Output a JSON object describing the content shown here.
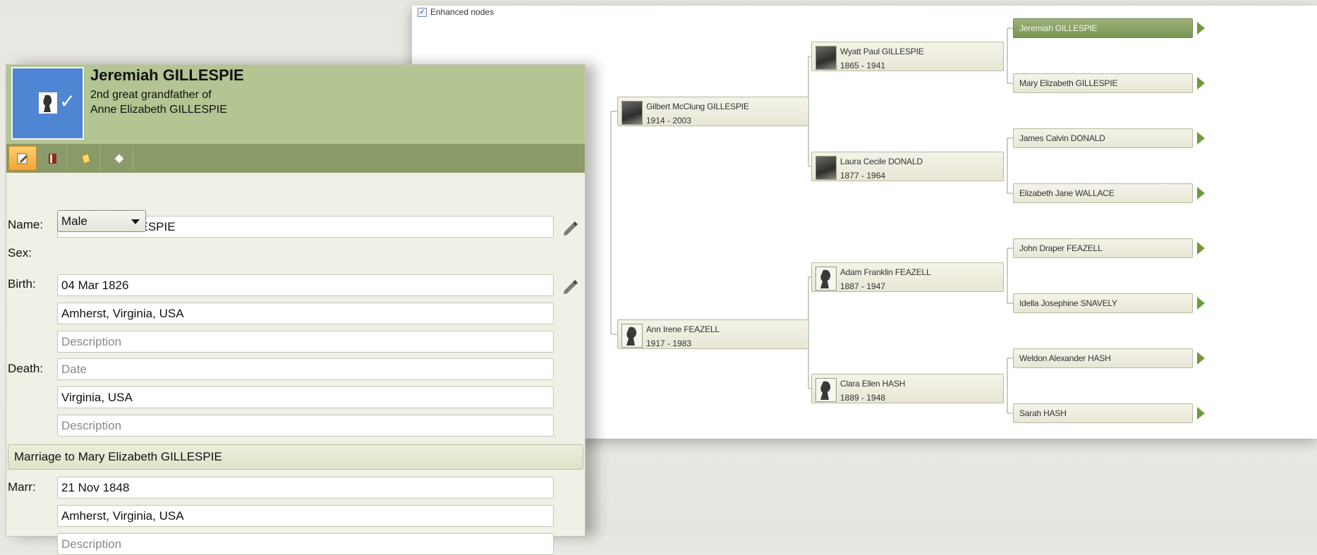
{
  "tree": {
    "enhanced_nodes_label": "Enhanced nodes",
    "enhanced_nodes_checked": true,
    "nodes": {
      "gilbert": {
        "name": "Gilbert McClung GILLESPIE",
        "dates": "1914 - 2003"
      },
      "ann": {
        "name": "Ann Irene FEAZELL",
        "dates": "1917 - 1983"
      },
      "wyatt": {
        "name": "Wyatt Paul GILLESPIE",
        "dates": "1865 - 1941"
      },
      "laura": {
        "name": "Laura Cecile DONALD",
        "dates": "1877 - 1964"
      },
      "adam": {
        "name": "Adam Franklin FEAZELL",
        "dates": "1887 - 1947"
      },
      "clara": {
        "name": "Clara Ellen HASH",
        "dates": "1889 - 1948"
      }
    },
    "leaves": [
      {
        "name": "Jeremiah GILLESPIE",
        "selected": true
      },
      {
        "name": "Mary Elizabeth GILLESPIE"
      },
      {
        "name": "James Calvin DONALD"
      },
      {
        "name": "Elizabeth Jane WALLACE"
      },
      {
        "name": "John Draper FEAZELL"
      },
      {
        "name": "Idella Josephine SNAVELY"
      },
      {
        "name": "Weldon Alexander HASH"
      },
      {
        "name": "Sarah HASH"
      }
    ]
  },
  "editor": {
    "name": "Jeremiah GILLESPIE",
    "relation_line1": "2nd great grandfather of",
    "relation_line2": "Anne Elizabeth GILLESPIE",
    "labels": {
      "name": "Name:",
      "sex": "Sex:",
      "birth": "Birth:",
      "death": "Death:",
      "marr": "Marr:"
    },
    "fields": {
      "name_value": "Jeremiah GILLESPIE",
      "sex_value": "Male",
      "birth_date": "04 Mar 1826",
      "birth_place": "Amherst, Virginia, USA",
      "birth_description_placeholder": "Description",
      "death_date_placeholder": "Date",
      "death_place": "Virginia, USA",
      "death_description_placeholder": "Description",
      "marr_date": "21 Nov 1848",
      "marr_place": "Amherst, Virginia, USA",
      "marr_description_placeholder": "Description"
    },
    "marriage_header": "Marriage to Mary Elizabeth GILLESPIE",
    "toolbar_icons": [
      "edit-icon",
      "book-icon",
      "note-icon",
      "tag-icon"
    ],
    "colors": {
      "header": "#b3c592",
      "toolbar": "#8a9a68",
      "portrait": "#4f86d4",
      "accent": "#f2a437"
    }
  }
}
